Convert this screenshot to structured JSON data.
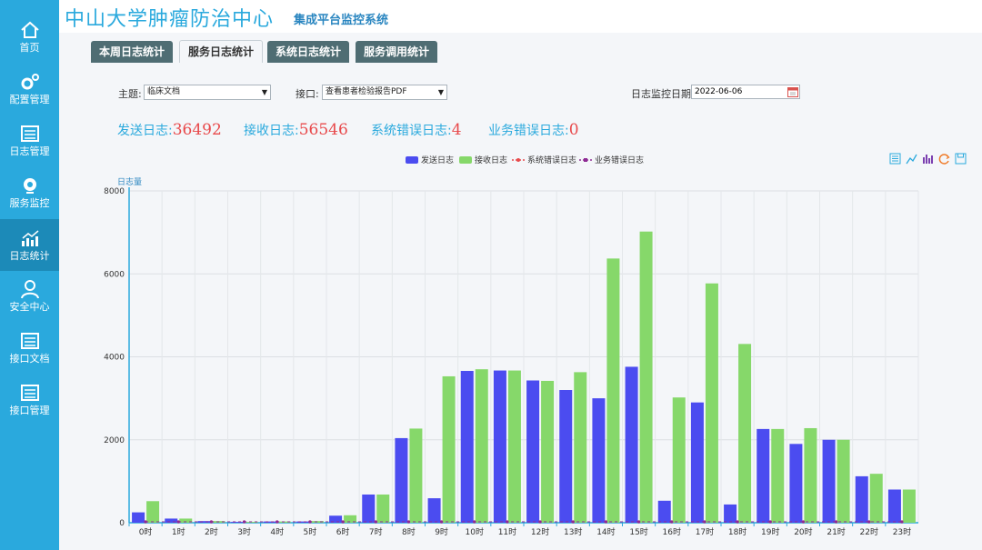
{
  "sidebar": {
    "items": [
      {
        "label": "首页",
        "icon": "home-icon"
      },
      {
        "label": "配置管理",
        "icon": "gears-icon"
      },
      {
        "label": "日志管理",
        "icon": "log-document-icon"
      },
      {
        "label": "服务监控",
        "icon": "monitor-camera-icon"
      },
      {
        "label": "日志统计",
        "icon": "stats-chart-icon",
        "active": true
      },
      {
        "label": "安全中心",
        "icon": "user-security-icon"
      },
      {
        "label": "接口文档",
        "icon": "interface-document-icon"
      },
      {
        "label": "接口管理",
        "icon": "interface-manage-icon"
      }
    ]
  },
  "header": {
    "title": "中山大学肿瘤防治中心",
    "subtitle": "集成平台监控系统"
  },
  "tabs": [
    {
      "label": "本周日志统计"
    },
    {
      "label": "服务日志统计",
      "active": true
    },
    {
      "label": "系统日志统计"
    },
    {
      "label": "服务调用统计"
    }
  ],
  "filters": {
    "topic_label": "主题:",
    "topic_value": "临床文档",
    "interface_label": "接口:",
    "interface_value": "查看患者检验报告PDF",
    "date_label": "日志监控日期:",
    "date_value": "2022-06-06"
  },
  "stats": {
    "send_label": "发送日志:",
    "send_value": "36492",
    "recv_label": "接收日志:",
    "recv_value": "56546",
    "syserr_label": "系统错误日志:",
    "syserr_value": "4",
    "bizerr_label": "业务错误日志:",
    "bizerr_value": "0"
  },
  "colors": {
    "brand": "#2aa9dd",
    "send": "#4b4cf0",
    "recv": "#86d86a",
    "syserr": "#e8494b",
    "bizerr": "#8e2b94"
  },
  "chart_data": {
    "type": "bar",
    "ylabel": "日志量",
    "ylim": [
      0,
      8000
    ],
    "yticks": [
      0,
      2000,
      4000,
      6000,
      8000
    ],
    "grid": true,
    "legend_position": "top",
    "categories": [
      "0时",
      "1时",
      "2时",
      "3时",
      "4时",
      "5时",
      "6时",
      "7时",
      "8时",
      "9时",
      "10时",
      "11时",
      "12时",
      "13时",
      "14时",
      "15时",
      "16时",
      "17时",
      "18时",
      "19时",
      "20时",
      "21时",
      "22时",
      "23时"
    ],
    "series": [
      {
        "name": "发送日志",
        "type": "bar",
        "values": [
          250,
          100,
          40,
          20,
          30,
          30,
          170,
          680,
          2040,
          590,
          3660,
          3670,
          3430,
          3200,
          3000,
          3760,
          530,
          2900,
          440,
          2260,
          1900,
          2000,
          1120,
          800
        ]
      },
      {
        "name": "接收日志",
        "type": "bar",
        "values": [
          520,
          100,
          40,
          20,
          30,
          40,
          180,
          680,
          2270,
          3530,
          3700,
          3670,
          3420,
          3630,
          6370,
          7020,
          3020,
          5770,
          4310,
          2260,
          2280,
          2000,
          1180,
          800
        ]
      },
      {
        "name": "系统错误日志",
        "type": "line",
        "values": [
          0,
          0,
          0,
          0,
          0,
          0,
          0,
          0,
          0,
          0,
          0,
          0,
          0,
          0,
          0,
          0,
          0,
          0,
          0,
          0,
          0,
          0,
          0,
          0
        ]
      },
      {
        "name": "业务错误日志",
        "type": "line",
        "values": [
          0,
          0,
          0,
          0,
          0,
          0,
          0,
          0,
          0,
          0,
          0,
          0,
          0,
          0,
          0,
          0,
          0,
          0,
          0,
          0,
          0,
          0,
          0,
          0
        ]
      }
    ]
  }
}
